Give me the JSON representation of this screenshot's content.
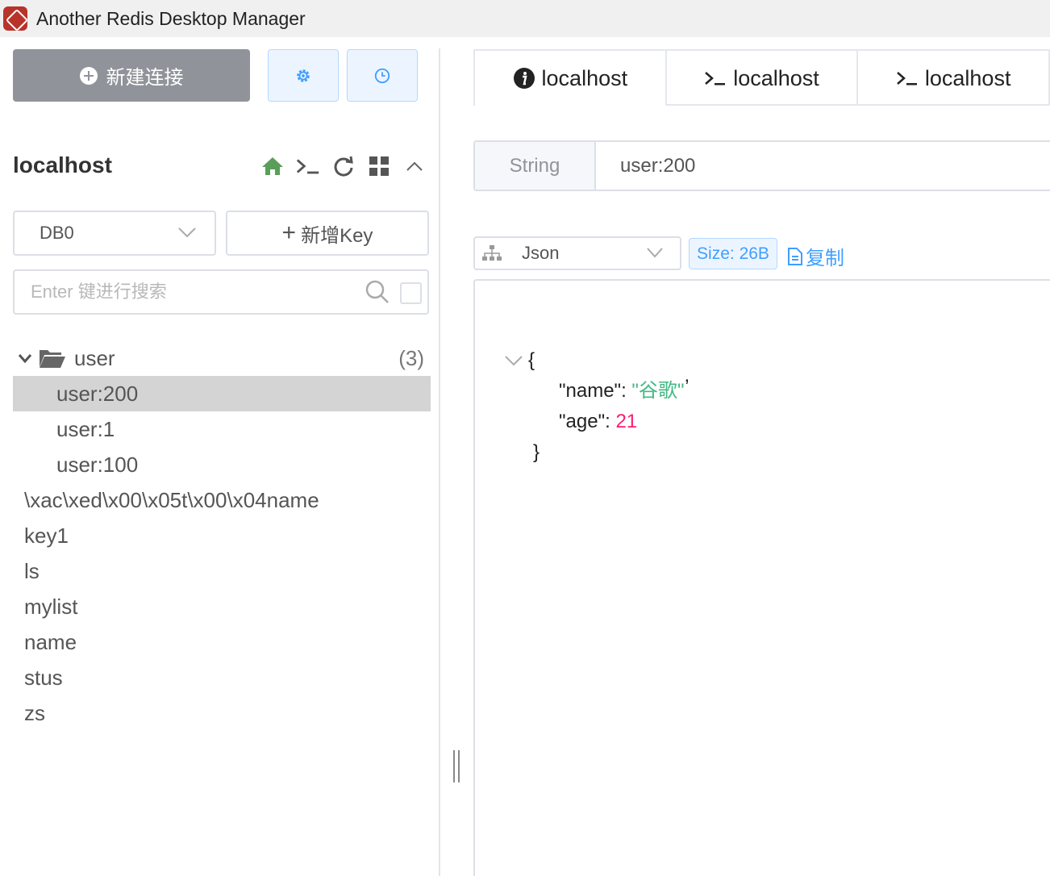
{
  "window": {
    "title": "Another Redis Desktop Manager"
  },
  "toolbar": {
    "new_connection_label": "新建连接"
  },
  "connection": {
    "name": "localhost",
    "db": "DB0",
    "add_key_label": "新增Key",
    "search_placeholder": "Enter 键进行搜索"
  },
  "tree": {
    "folder": {
      "name": "user",
      "count": "(3)"
    },
    "children": [
      "user:200",
      "user:1",
      "user:100"
    ],
    "selected": "user:200",
    "keys": [
      "\\xac\\xed\\x00\\x05t\\x00\\x04name",
      "key1",
      "ls",
      "mylist",
      "name",
      "stus",
      "zs"
    ]
  },
  "tabs": [
    {
      "label": "localhost",
      "icon": "info-icon"
    },
    {
      "label": "localhost",
      "icon": "terminal-icon"
    },
    {
      "label": "localhost",
      "icon": "terminal-icon"
    }
  ],
  "detail": {
    "type": "String",
    "key": "user:200",
    "format": "Json",
    "size": "Size: 26B",
    "copy_label": "复制",
    "json": {
      "open": "{",
      "name_key": "\"name\"",
      "name_value": "\"谷歌\"",
      "age_key": "\"age\"",
      "age_value": "21",
      "close": "}"
    }
  },
  "colors": {
    "primary": "#409eff",
    "button_gray": "#909399",
    "selected_row": "#d4d4d4",
    "json_string": "#42b983",
    "json_number": "#fc1e70",
    "home_icon": "#5a9e5a"
  }
}
